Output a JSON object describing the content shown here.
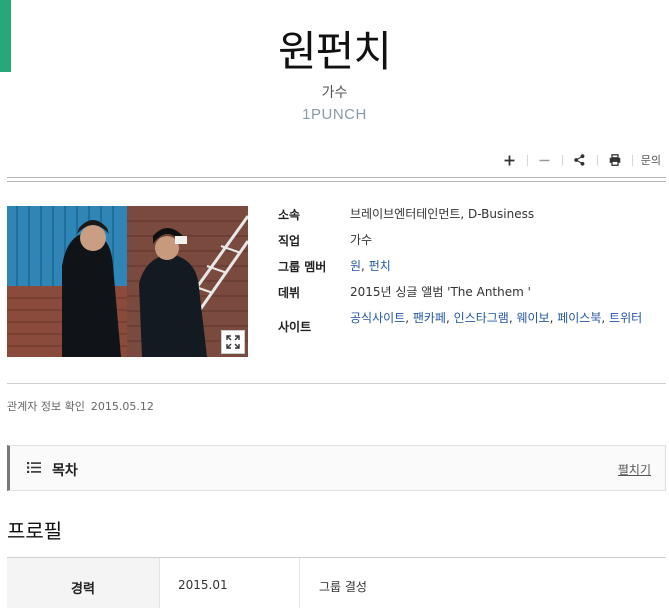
{
  "header": {
    "title": "원펀치",
    "subtitle": "가수",
    "roman_name": "1PUNCH"
  },
  "toolbar": {
    "zoom_in_icon": "plus-icon",
    "zoom_out_icon": "minus-icon",
    "share_icon": "share-icon",
    "print_icon": "print-icon",
    "inquiry_label": "문의"
  },
  "colors": {
    "accent": "#27a87a",
    "link": "#2356a3"
  },
  "info": {
    "agency": {
      "label": "소속",
      "value": "브레이브엔터테인먼트, D-Business"
    },
    "job": {
      "label": "직업",
      "value": "가수"
    },
    "members": {
      "label": "그룹 멤버",
      "items": [
        "원",
        "펀치"
      ],
      "separator": ", "
    },
    "debut": {
      "label": "데뷔",
      "value": "2015년 싱글 앨범 'The Anthem '"
    },
    "sites": {
      "label": "사이트",
      "items": [
        "공식사이트",
        "팬카페",
        "인스타그램",
        "웨이보",
        "페이스북",
        "트위터"
      ],
      "separator": ", "
    }
  },
  "verified": {
    "label": "관계자 정보 확인",
    "date": "2015.05.12"
  },
  "toc": {
    "title": "목차",
    "toggle_label": "펼치기"
  },
  "profile": {
    "heading": "프로필",
    "career": {
      "label": "경력",
      "date": "2015.01",
      "event": "그룹 결성"
    }
  }
}
